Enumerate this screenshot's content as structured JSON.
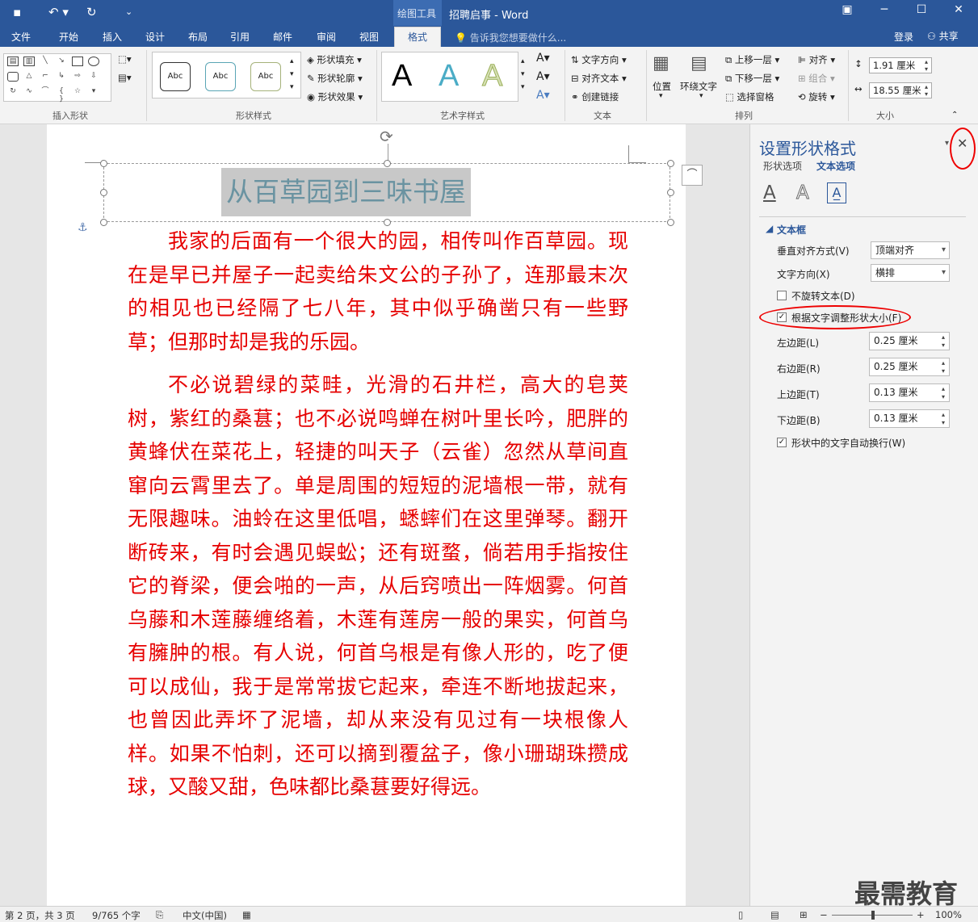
{
  "app": {
    "doc_title": "招聘启事 - Word",
    "context_tab_group": "绘图工具"
  },
  "tabs": [
    "文件",
    "开始",
    "插入",
    "设计",
    "布局",
    "引用",
    "邮件",
    "审阅",
    "视图"
  ],
  "active_tab": "格式",
  "tell_me": "告诉我您想要做什么...",
  "account": {
    "login": "登录",
    "share": "共享"
  },
  "ribbon": {
    "insert_shapes": {
      "label": "插入形状"
    },
    "shape_styles": {
      "label": "形状样式",
      "sample": "Abc",
      "fill": "形状填充",
      "outline": "形状轮廓",
      "effects": "形状效果"
    },
    "wordart": {
      "label": "艺术字样式",
      "sample": "A"
    },
    "text": {
      "label": "文本",
      "direction": "文字方向",
      "align": "对齐文本",
      "link": "创建链接"
    },
    "arrange": {
      "label": "排列",
      "position": "位置",
      "wrap": "环绕文字",
      "forward": "上移一层",
      "backward": "下移一层",
      "pane": "选择窗格",
      "align": "对齐",
      "group": "组合",
      "rotate": "旋转"
    },
    "size": {
      "label": "大小",
      "height": "1.91 厘米",
      "width": "18.55 厘米"
    }
  },
  "document": {
    "heading": "从百草园到三味书屋",
    "paragraphs": [
      "我家的后面有一个很大的园，相传叫作百草园。现在是早已并屋子一起卖给朱文公的子孙了，连那最末次的相见也已经隔了七八年，其中似乎确凿只有一些野草；但那时却是我的乐园。",
      "不必说碧绿的菜畦，光滑的石井栏，高大的皂荚树，紫红的桑葚；也不必说鸣蝉在树叶里长吟，肥胖的黄蜂伏在菜花上，轻捷的叫天子（云雀）忽然从草间直窜向云霄里去了。单是周围的短短的泥墙根一带，就有无限趣味。油蛉在这里低唱，蟋蟀们在这里弹琴。翻开断砖来，有时会遇见蜈蚣；还有斑蝥，倘若用手指按住它的脊梁，便会啪的一声，从后窍喷出一阵烟雾。何首乌藤和木莲藤缠络着，木莲有莲房一般的果实，何首乌有臃肿的根。有人说，何首乌根是有像人形的，吃了便可以成仙，我于是常常拔它起来，牵连不断地拔起来，也曾因此弄坏了泥墙，却从来没有见过有一块根像人样。如果不怕刺，还可以摘到覆盆子，像小珊瑚珠攒成球，又酸又甜，色味都比桑葚要好得远。"
    ]
  },
  "pane": {
    "title": "设置形状格式",
    "tab_shape": "形状选项",
    "tab_text": "文本选项",
    "section": "文本框",
    "vertical_align_label": "垂直对齐方式(V)",
    "vertical_align_value": "顶端对齐",
    "text_dir_label": "文字方向(X)",
    "text_dir_value": "横排",
    "no_rotate": "不旋转文本(D)",
    "autofit": "根据文字调整形状大小(F)",
    "left_margin_label": "左边距(L)",
    "left_margin": "0.25 厘米",
    "right_margin_label": "右边距(R)",
    "right_margin": "0.25 厘米",
    "top_margin_label": "上边距(T)",
    "top_margin": "0.13 厘米",
    "bottom_margin_label": "下边距(B)",
    "bottom_margin": "0.13 厘米",
    "wrap_text": "形状中的文字自动换行(W)"
  },
  "status": {
    "page": "第 2 页，共 3 页",
    "words": "9/765 个字",
    "lang": "中文(中国)",
    "zoom": "100%"
  },
  "watermark": "最需教育"
}
